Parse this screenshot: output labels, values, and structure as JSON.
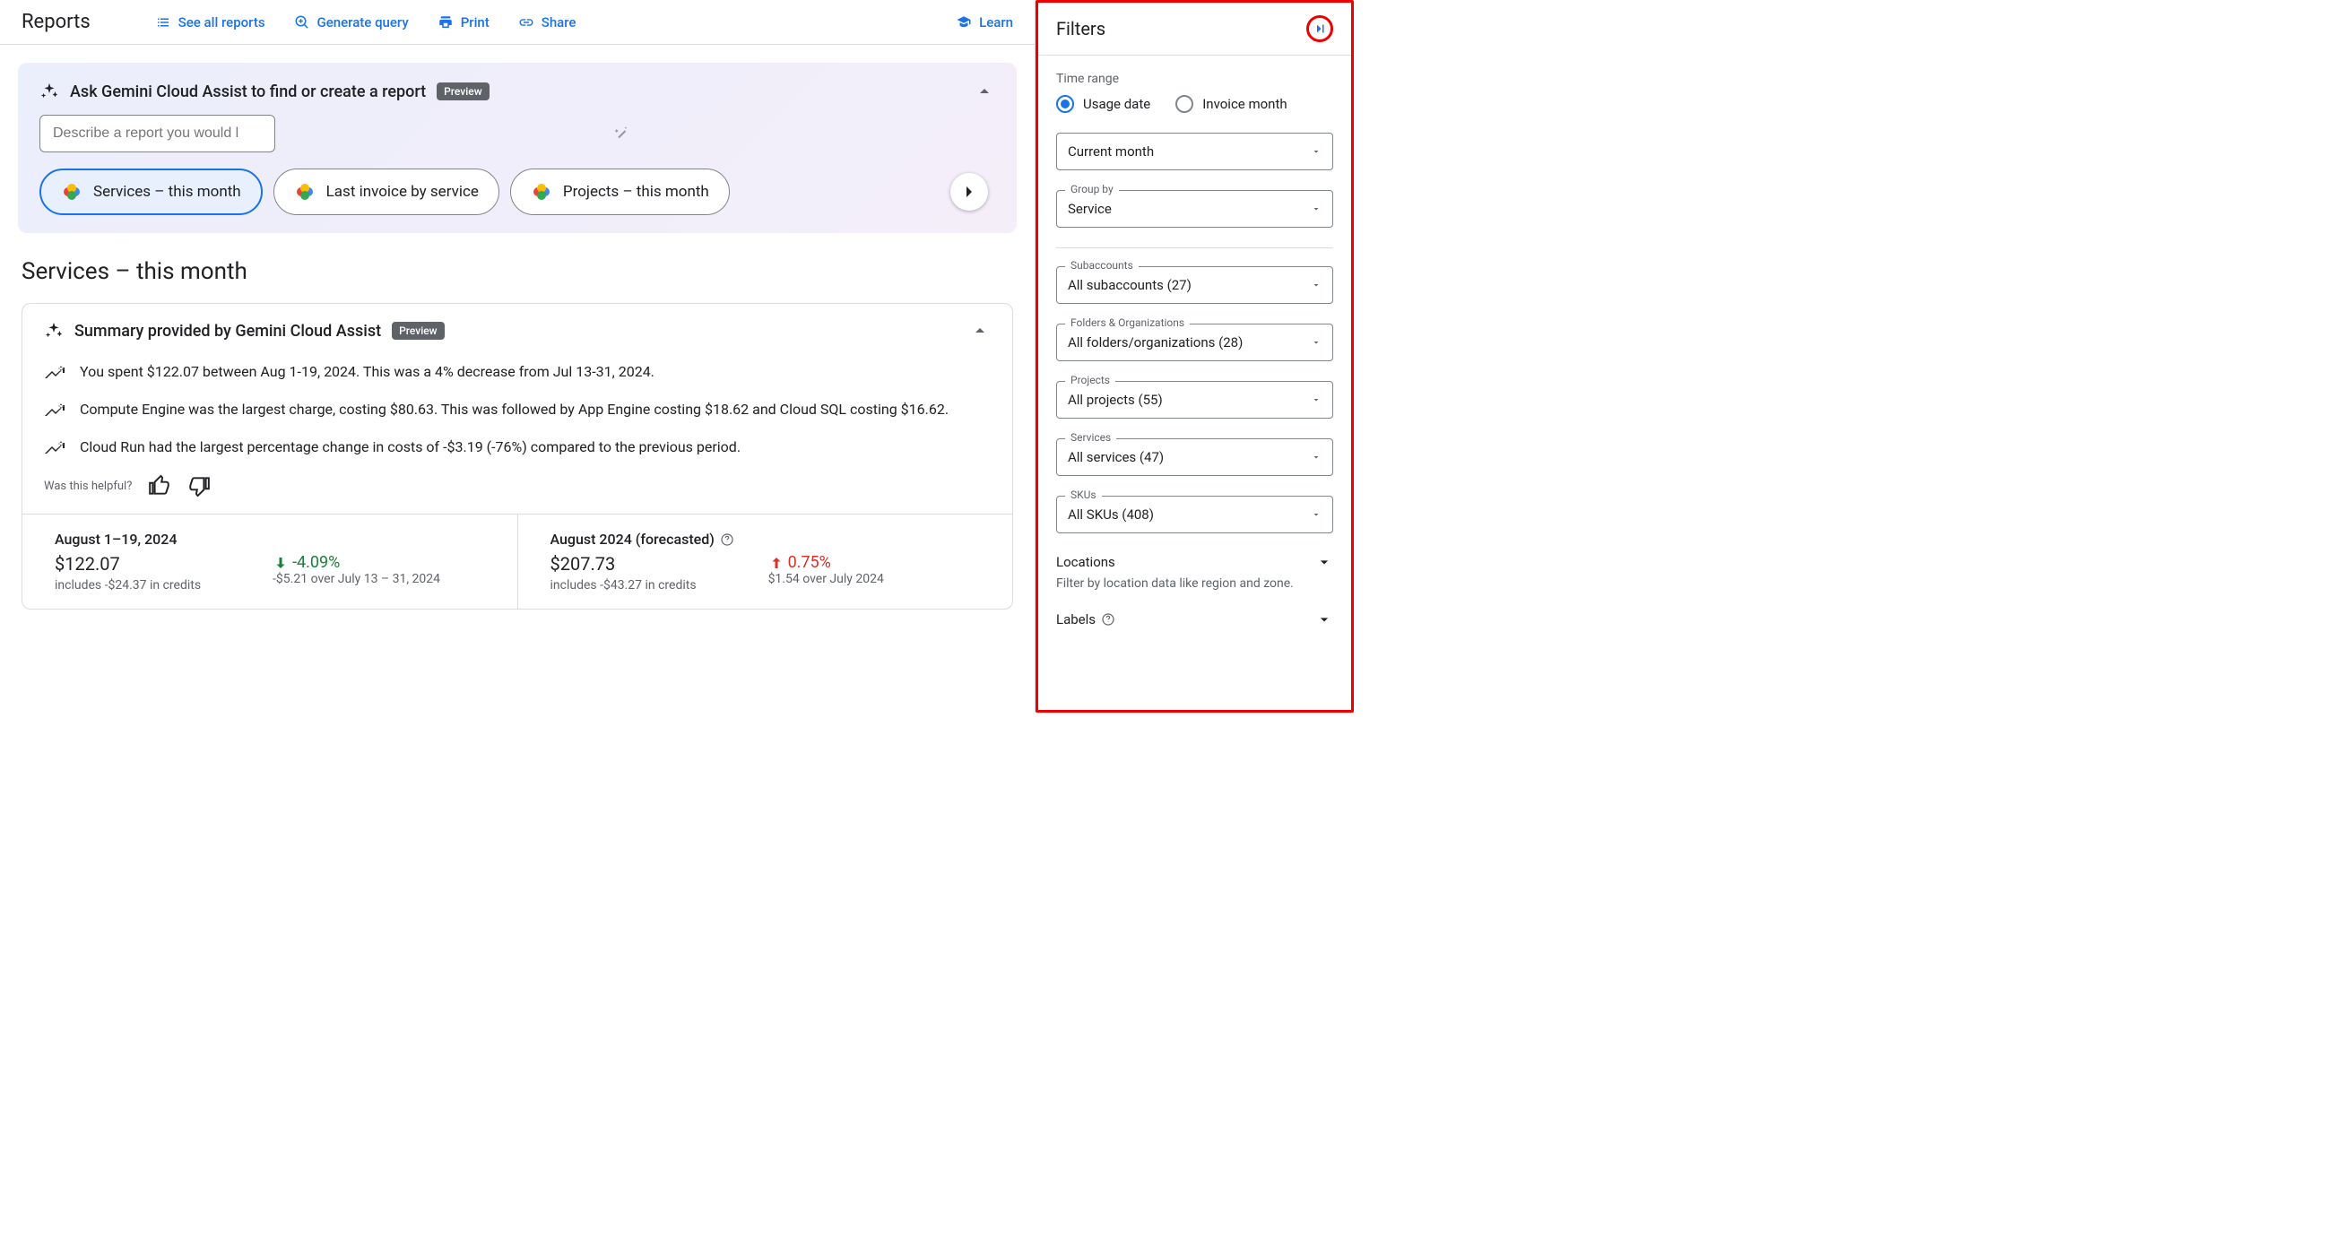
{
  "toolbar": {
    "title": "Reports",
    "see_all": "See all reports",
    "gen_query": "Generate query",
    "print": "Print",
    "share": "Share",
    "learn": "Learn"
  },
  "gemini": {
    "title": "Ask Gemini Cloud Assist to find or create a report",
    "preview": "Preview",
    "placeholder": "Describe a report you would like to view",
    "chips": [
      "Services – this month",
      "Last invoice by service",
      "Projects – this month"
    ]
  },
  "section_title": "Services – this month",
  "summary": {
    "title": "Summary provided by Gemini Cloud Assist",
    "preview": "Preview",
    "insights": [
      "You spent $122.07 between Aug 1-19, 2024. This was a 4% decrease from Jul 13-31, 2024.",
      "Compute Engine was the largest charge, costing $80.63. This was followed by App Engine costing $18.62 and Cloud SQL costing $16.62.",
      "Cloud Run had the largest percentage change in costs of -$3.19 (-76%) compared to the previous period."
    ],
    "feedback": "Was this helpful?"
  },
  "stats": {
    "left": {
      "period": "August 1–19, 2024",
      "amount": "$122.07",
      "sub": "includes -$24.37 in credits",
      "change": "-4.09%",
      "change_sub": "-$5.21 over July 13 – 31, 2024"
    },
    "right": {
      "period": "August 2024 (forecasted)",
      "amount": "$207.73",
      "sub": "includes -$43.27 in credits",
      "change": "0.75%",
      "change_sub": "$1.54 over July 2024"
    }
  },
  "filters": {
    "title": "Filters",
    "time_range_label": "Time range",
    "radio1": "Usage date",
    "radio2": "Invoice month",
    "current_month": "Current month",
    "group_by_label": "Group by",
    "group_by": "Service",
    "subaccounts_label": "Subaccounts",
    "subaccounts": "All subaccounts (27)",
    "folders_label": "Folders & Organizations",
    "folders": "All folders/organizations (28)",
    "projects_label": "Projects",
    "projects": "All projects (55)",
    "services_label": "Services",
    "services": "All services (47)",
    "skus_label": "SKUs",
    "skus": "All SKUs (408)",
    "locations": "Locations",
    "locations_desc": "Filter by location data like region and zone.",
    "labels": "Labels"
  }
}
